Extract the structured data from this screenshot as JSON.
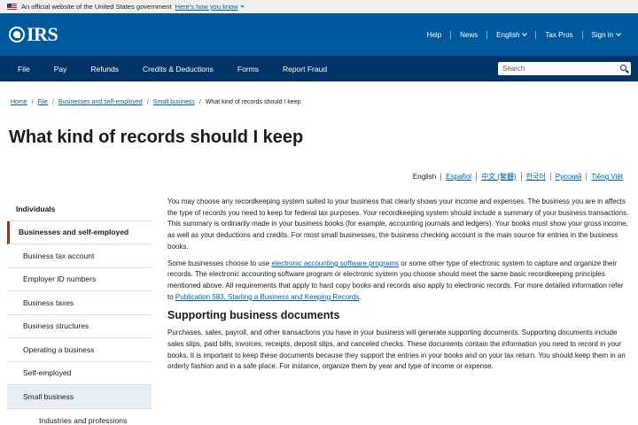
{
  "gov_banner": {
    "text": "An official website of the United States government",
    "link": "Here's how you know"
  },
  "header": {
    "logo_text": "IRS",
    "util_nav": [
      "Help",
      "News",
      "English",
      "Tax Pros",
      "Sign in"
    ]
  },
  "mainnav": {
    "items": [
      "File",
      "Pay",
      "Refunds",
      "Credits & Deductions",
      "Forms",
      "Report Fraud"
    ],
    "search_placeholder": "Search"
  },
  "breadcrumb": [
    "Home",
    "File",
    "Businesses and self-employed",
    "Small business",
    "What kind of records should I keep"
  ],
  "page_title": "What kind of records should I keep",
  "languages": [
    "English",
    "Español",
    "中文 (繁體)",
    "한국어",
    "Русский",
    "Tiếng Việt"
  ],
  "sidebar": {
    "items": [
      "Individuals",
      "Businesses and self-employed",
      "Business tax account",
      "Employer ID numbers",
      "Business taxes",
      "Business structures",
      "Operating a business",
      "Self-employed",
      "Small business",
      "Industries and professions"
    ]
  },
  "content": {
    "p1": "You may choose any recordkeeping system suited to your business that clearly shows your income and expenses. The business you are in affects the type of records you need to keep for federal tax purposes. Your recordkeeping system should include a summary of your business transactions. This summary is ordinarily made in your business books (for example, accounting journals and ledgers). Your books must show your gross income, as well as your deductions and credits. For most small businesses, the business checking account is the main source for entries in the business books.",
    "p2_a": "Some businesses choose to use ",
    "p2_link": "electronic accounting software programs",
    "p2_b": " or some other type of electronic system to capture and organize their records. The electronic accounting software program or electronic system you choose should meet the same basic recordkeeping principles mentioned above. All requirements that apply to hard copy books and records also apply to electronic records. For more detailed information refer to ",
    "p2_link2": "Publication 583, Starting a Business and Keeping Records",
    "p2_c": ".",
    "h2": "Supporting business documents",
    "p3": "Purchases, sales, payroll, and other transactions you have in your business will generate supporting documents. Supporting documents include sales slips, paid bills, invoices, receipts, deposit slips, and canceled checks. These documents contain the information you need to record in your books. It is important to keep these documents because they support the entries in your books and on your tax return. You should keep them in an orderly fashion and in a safe place. For instance, organize them by year and type of income or expense."
  }
}
